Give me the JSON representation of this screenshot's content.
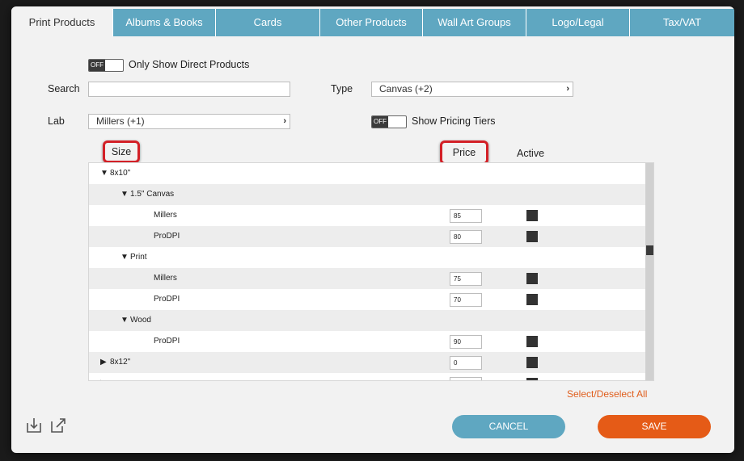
{
  "tabs": [
    "Print Products",
    "Albums & Books",
    "Cards",
    "Other Products",
    "Wall Art Groups",
    "Logo/Legal",
    "Tax/VAT"
  ],
  "filters": {
    "direct_toggle_state": "OFF",
    "direct_label": "Only Show Direct Products",
    "search_label": "Search",
    "search_value": "",
    "type_label": "Type",
    "type_value": "Canvas (+2)",
    "lab_label": "Lab",
    "lab_value": "Millers (+1)",
    "tiers_toggle_state": "OFF",
    "tiers_label": "Show Pricing Tiers"
  },
  "columns": {
    "size": "Size",
    "price": "Price",
    "active": "Active"
  },
  "rows": [
    {
      "label": "8x10\"",
      "price": "",
      "expanded": true
    },
    {
      "label": "1.5\" Canvas",
      "price": "",
      "expanded": true
    },
    {
      "label": "Millers",
      "price": "85"
    },
    {
      "label": "ProDPI",
      "price": "80"
    },
    {
      "label": "Print",
      "price": "",
      "expanded": true
    },
    {
      "label": "Millers",
      "price": "75"
    },
    {
      "label": "ProDPI",
      "price": "70"
    },
    {
      "label": "Wood",
      "price": "",
      "expanded": true
    },
    {
      "label": "ProDPI",
      "price": "90"
    },
    {
      "label": "8x12\"",
      "price": "0",
      "expanded": false
    }
  ],
  "select_all": "Select/Deselect All",
  "buttons": {
    "cancel": "CANCEL",
    "save": "SAVE"
  },
  "icons": [
    "import-icon",
    "external-link-icon"
  ],
  "colors": {
    "tab": "#5fa7c1",
    "save": "#e55b17",
    "highlight": "#d32027",
    "link": "#e05e1d"
  }
}
